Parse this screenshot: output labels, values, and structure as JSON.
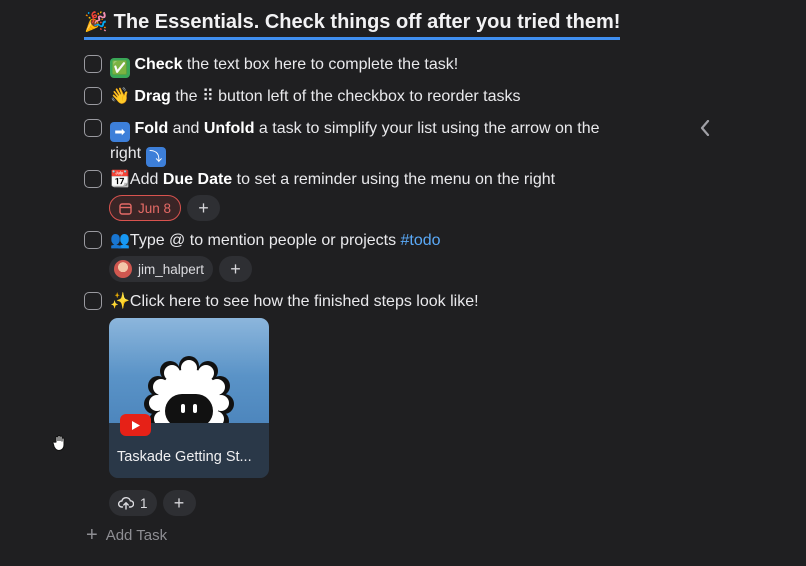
{
  "heading": {
    "emoji": "🎉",
    "title": "The Essentials. Check things off after you tried them!"
  },
  "tasks": [
    {
      "emoji": "✅",
      "bold": "Check",
      "text": " the text box here to complete the task!"
    },
    {
      "emoji": "👋",
      "bold": "Drag",
      "text_a": " the ",
      "handle": "⠿",
      "text_b": " button left of the checkbox to reorder tasks"
    },
    {
      "emoji": "➡",
      "bold1": "Fold",
      "mid": " and ",
      "bold2": "Unfold",
      "text": " a task to simplify your list using the arrow on the right",
      "trail_emoji": "⤵"
    },
    {
      "emoji": "📆",
      "pre": "Add ",
      "bold": "Due Date",
      "text": " to set a reminder using the menu on the right",
      "date_chip": "Jun 8"
    },
    {
      "emoji": "👥",
      "text": "Type @ to mention people or projects ",
      "hashtag": "#todo",
      "mention": "jim_halpert"
    },
    {
      "emoji": "✨",
      "text": "Click here to see how the finished steps look like!",
      "video_title": "Taskade Getting St...",
      "upload_count": "1"
    }
  ],
  "add_plus": "+",
  "add_task": {
    "icon": "+",
    "label": "Add Task"
  },
  "collapse_icon": "‹",
  "colors": {
    "accent": "#3f8ef0",
    "date": "#e56a66",
    "hashtag": "#5aa9f7",
    "youtube": "#e62117"
  }
}
